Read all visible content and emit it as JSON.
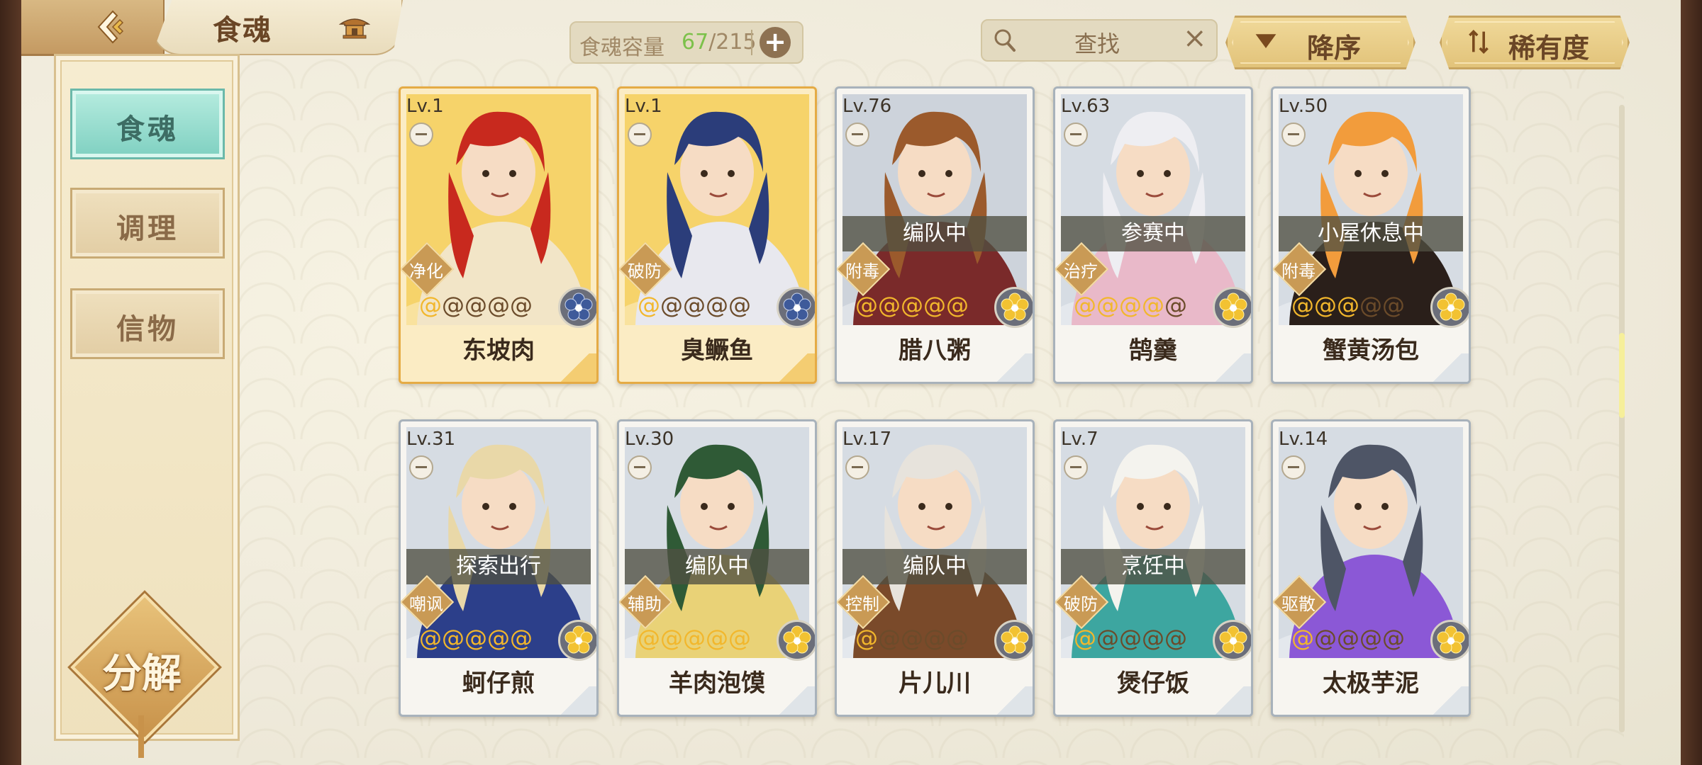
{
  "header": {
    "title": "食魂",
    "capacity_label": "食魂容量",
    "capacity_current": "67",
    "capacity_total": "/215",
    "search_placeholder": "查找",
    "sort_order_label": "降序",
    "sort_rarity_label": "稀有度"
  },
  "sidebar": {
    "items": [
      {
        "label": "食魂",
        "active": true
      },
      {
        "label": "调理",
        "active": false
      },
      {
        "label": "信物",
        "active": false
      }
    ],
    "decompose_label": "分解"
  },
  "cards": [
    {
      "level": "Lv.1",
      "name": "东坡肉",
      "role": "净化",
      "status": "",
      "stars": 1,
      "emblem": "blue-flower-icon",
      "frame": "gold",
      "palette": [
        "#f6d36a",
        "#c8291e",
        "#f2e5c7"
      ]
    },
    {
      "level": "Lv.1",
      "name": "臭鳜鱼",
      "role": "破防",
      "status": "",
      "stars": 1,
      "emblem": "blue-flower-icon",
      "frame": "gold",
      "palette": [
        "#f6d36a",
        "#2b3d7a",
        "#e8e8ee"
      ]
    },
    {
      "level": "Lv.76",
      "name": "腊八粥",
      "role": "附毒",
      "status": "编队中",
      "stars": 5,
      "emblem": "gold-flower-icon",
      "frame": "silver",
      "palette": [
        "#cdd3db",
        "#9b5a2c",
        "#7a2a2a"
      ]
    },
    {
      "level": "Lv.63",
      "name": "鹄羹",
      "role": "治疗",
      "status": "参赛中",
      "stars": 4,
      "emblem": "gold-flower-icon",
      "frame": "silver",
      "palette": [
        "#d6dce3",
        "#eeeef2",
        "#e9b9c9"
      ]
    },
    {
      "level": "Lv.50",
      "name": "蟹黄汤包",
      "role": "附毒",
      "status": "小屋休息中",
      "stars": 3,
      "emblem": "gold-flower-icon",
      "frame": "silver",
      "palette": [
        "#d6dce3",
        "#f29c3c",
        "#2a1f1a"
      ]
    },
    {
      "level": "Lv.31",
      "name": "蚵仔煎",
      "role": "嘲讽",
      "status": "探索出行",
      "stars": 5,
      "emblem": "gold-flower-icon",
      "frame": "silver",
      "palette": [
        "#d6dce3",
        "#e9d8a8",
        "#2c3f8a"
      ]
    },
    {
      "level": "Lv.30",
      "name": "羊肉泡馍",
      "role": "辅助",
      "status": "编队中",
      "stars": 5,
      "emblem": "gold-flower-icon",
      "frame": "silver",
      "palette": [
        "#d6dce3",
        "#2f5a36",
        "#e9d277"
      ]
    },
    {
      "level": "Lv.17",
      "name": "片儿川",
      "role": "控制",
      "status": "编队中",
      "stars": 1,
      "emblem": "gold-flower-icon",
      "frame": "silver",
      "palette": [
        "#d6dce3",
        "#e7e3dc",
        "#7a4a2a"
      ]
    },
    {
      "level": "Lv.7",
      "name": "煲仔饭",
      "role": "破防",
      "status": "烹饪中",
      "stars": 1,
      "emblem": "gold-flower-icon",
      "frame": "silver",
      "palette": [
        "#d6dce3",
        "#f4f3ee",
        "#3da6a0"
      ]
    },
    {
      "level": "Lv.14",
      "name": "太极芋泥",
      "role": "驱散",
      "status": "",
      "stars": 1,
      "emblem": "gold-flower-icon",
      "frame": "silver",
      "palette": [
        "#d6dce3",
        "#4e5566",
        "#8b58d6"
      ]
    }
  ]
}
